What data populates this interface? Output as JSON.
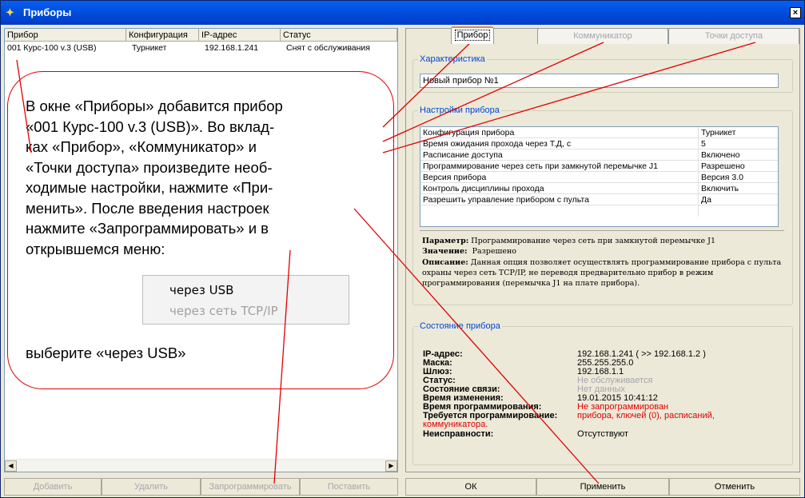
{
  "window": {
    "title": "Приборы"
  },
  "device_list": {
    "columns": [
      "Прибор",
      "Конфигурация",
      "IP-адрес",
      "Статус"
    ],
    "rows": [
      {
        "device": "001 Курс-100 v.3 (USB)",
        "config": "Турникет",
        "ip": "192.168.1.241",
        "status": "Снят с обслуживания"
      }
    ]
  },
  "left_buttons": {
    "add": "Добавить",
    "delete": "Удалить",
    "program": "Запрограммировать",
    "install": "Поставить"
  },
  "tabs": {
    "device": "Прибор",
    "communicator": "Коммуникатор",
    "access_points": "Точки доступа"
  },
  "characteristic": {
    "legend": "Характеристика",
    "name_value": "Новый прибор №1"
  },
  "settings": {
    "legend": "Настройки прибора",
    "rows": [
      {
        "key": "Конфигурация прибора",
        "value": "Турникет"
      },
      {
        "key": "Время ожидания прохода через Т.Д, с",
        "value": "5"
      },
      {
        "key": "Расписание доступа",
        "value": "Включено"
      },
      {
        "key": "Программирование через сеть при замкнутой перемычке J1",
        "value": "Разрешено"
      },
      {
        "key": "Версия прибора",
        "value": "Версия 3.0"
      },
      {
        "key": "Контроль дисциплины прохода",
        "value": "Включить"
      },
      {
        "key": "Разрешить управление прибором с пульта",
        "value": "Да"
      }
    ],
    "param_label": "Параметр:",
    "param_value": "Программирование через сеть при замкнутой перемычке J1",
    "meaning_label": "Значение:",
    "meaning_value": "Разрешено",
    "desc_label": "Описание:",
    "desc_line1": "Данная опция позволяет осуществлять программирование прибора с пульта",
    "desc_line2": "охраны через сеть TCP/IP, не переводя предварительно прибор в режим",
    "desc_line3": "программирования (перемычка J1 на плате прибора)."
  },
  "device_status": {
    "legend": "Состояние прибора",
    "ip_label": "IP-адрес:",
    "ip_value": "192.168.1.241   ( >> 192.168.1.2 )",
    "mask_label": "Маска:",
    "mask_value": "255.255.255.0",
    "gateway_label": "Шлюз:",
    "gateway_value": "192.168.1.1",
    "status_label": "Статус:",
    "status_value": "Не обслуживается",
    "link_label": "Состояние связи:",
    "link_value": "Нет данных",
    "changed_label": "Время изменения:",
    "changed_value": "19.01.2015 10:41:12",
    "programmed_label": "Время программирования:",
    "programmed_value": "Не запрограммирован",
    "required_label": "Требуется программирование:",
    "required_value_1": "прибора, ключей (0), расписаний,",
    "required_value_2": "коммуникатора.",
    "faults_label": "Неисправности:",
    "faults_value": "Отсутствуют"
  },
  "right_buttons": {
    "ok": "ОК",
    "apply": "Применить",
    "cancel": "Отменить"
  },
  "callout": {
    "l1": "В окне «Приборы» добавится прибор",
    "l2": "«001 Курс-100 v.3 (USB)». Во вклад-",
    "l3": "ках «Прибор», «Коммуникатор» и",
    "l4": "«Точки доступа» произведите необ-",
    "l5": "ходимые настройки, нажмите «При-",
    "l6": "менить». После введения настроек",
    "l7": "нажмите «Запрограммировать» и в",
    "l8": "открывшемся меню:",
    "menu_usb": "через USB",
    "menu_tcp": "через сеть TCP/IP",
    "footer": "выберите «через USB»"
  },
  "colors": {
    "callout_border": "#e00000",
    "link_blue": "#0046d5",
    "error_red": "#e00000"
  }
}
